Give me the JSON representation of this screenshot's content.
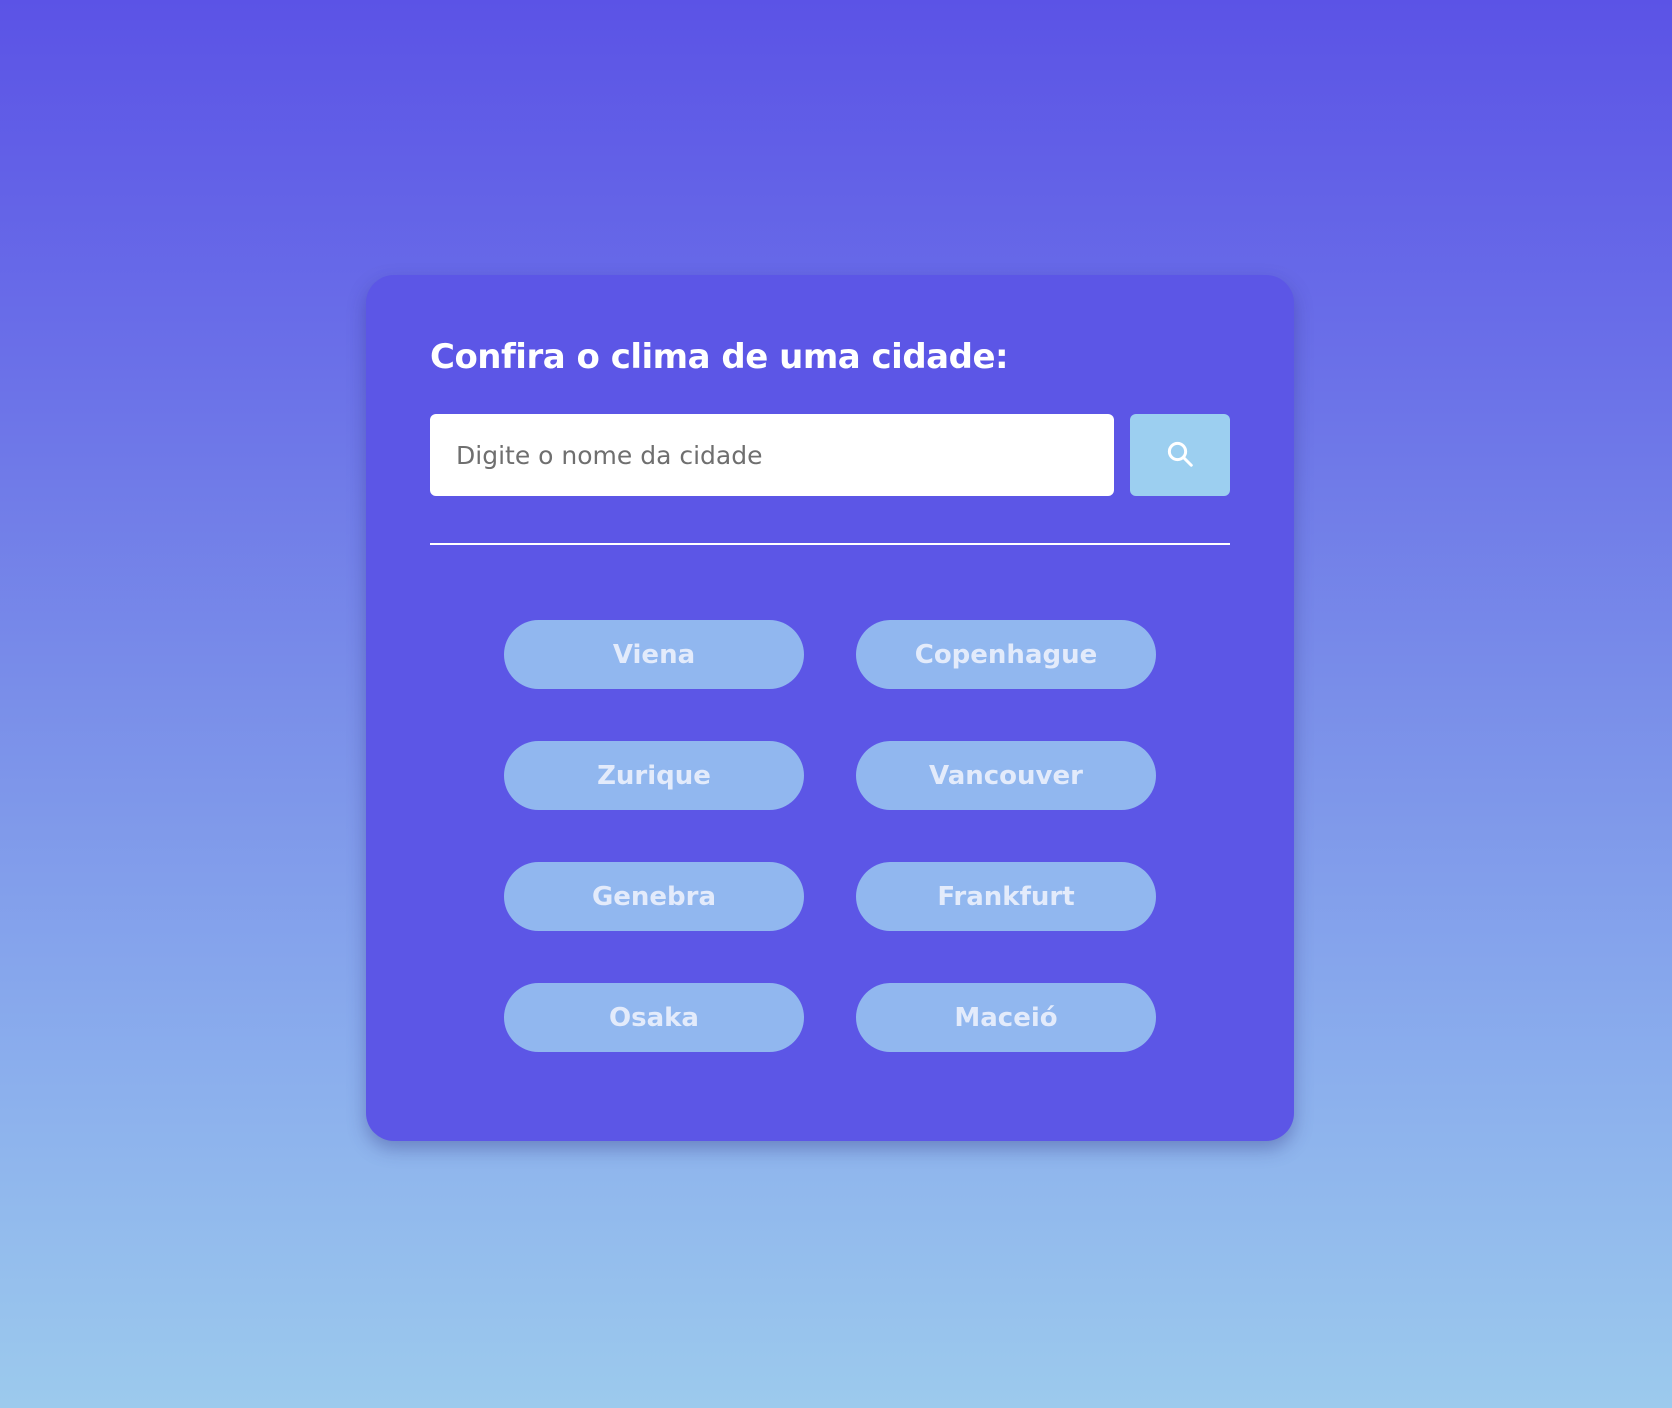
{
  "card": {
    "title": "Confira o clima de uma cidade:"
  },
  "search": {
    "placeholder": "Digite o nome da cidade",
    "value": "",
    "button_icon": "search-icon"
  },
  "cities": [
    {
      "label": "Viena"
    },
    {
      "label": "Copenhague"
    },
    {
      "label": "Zurique"
    },
    {
      "label": "Vancouver"
    },
    {
      "label": "Genebra"
    },
    {
      "label": "Frankfurt"
    },
    {
      "label": "Osaka"
    },
    {
      "label": "Maceió"
    }
  ],
  "colors": {
    "background_top": "#5b53e6",
    "background_bottom": "#9ccaed",
    "card": "#5c56e6",
    "search_button": "#9ccff0",
    "city_button": "#91b7ef",
    "city_text": "#e3ebfb"
  }
}
